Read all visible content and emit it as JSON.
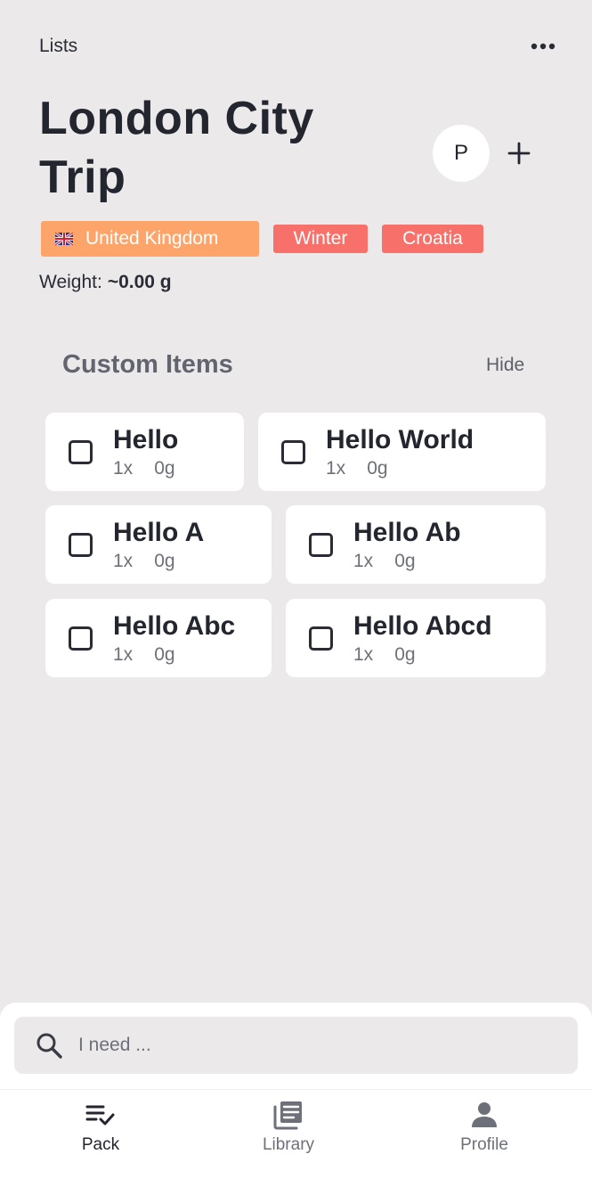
{
  "header": {
    "back_label": "Lists",
    "more_icon": "more-horizontal-icon",
    "title": "London City Trip",
    "avatar_initial": "P",
    "add_icon": "plus-icon"
  },
  "tags": [
    {
      "label": "United Kingdom",
      "flag_icon": "uk-flag-icon",
      "color": "#fca469"
    },
    {
      "label": "Winter",
      "color": "#f7716a"
    },
    {
      "label": "Croatia",
      "color": "#f7716a"
    }
  ],
  "weight": {
    "label": "Weight:",
    "value": "~0.00 g"
  },
  "section": {
    "title": "Custom Items",
    "hide_label": "Hide"
  },
  "items": [
    {
      "name": "Hello",
      "qty": "1x",
      "weight": "0g",
      "checked": false
    },
    {
      "name": "Hello World",
      "qty": "1x",
      "weight": "0g",
      "checked": false
    },
    {
      "name": "Hello A",
      "qty": "1x",
      "weight": "0g",
      "checked": false
    },
    {
      "name": "Hello Ab",
      "qty": "1x",
      "weight": "0g",
      "checked": false
    },
    {
      "name": "Hello Abc",
      "qty": "1x",
      "weight": "0g",
      "checked": false
    },
    {
      "name": "Hello Abcd",
      "qty": "1x",
      "weight": "0g",
      "checked": false
    }
  ],
  "search": {
    "placeholder": "I need ...",
    "icon": "search-icon"
  },
  "tabs": [
    {
      "label": "Pack",
      "icon": "pack-checklist-icon",
      "active": true
    },
    {
      "label": "Library",
      "icon": "library-icon",
      "active": false
    },
    {
      "label": "Profile",
      "icon": "profile-icon",
      "active": false
    }
  ]
}
